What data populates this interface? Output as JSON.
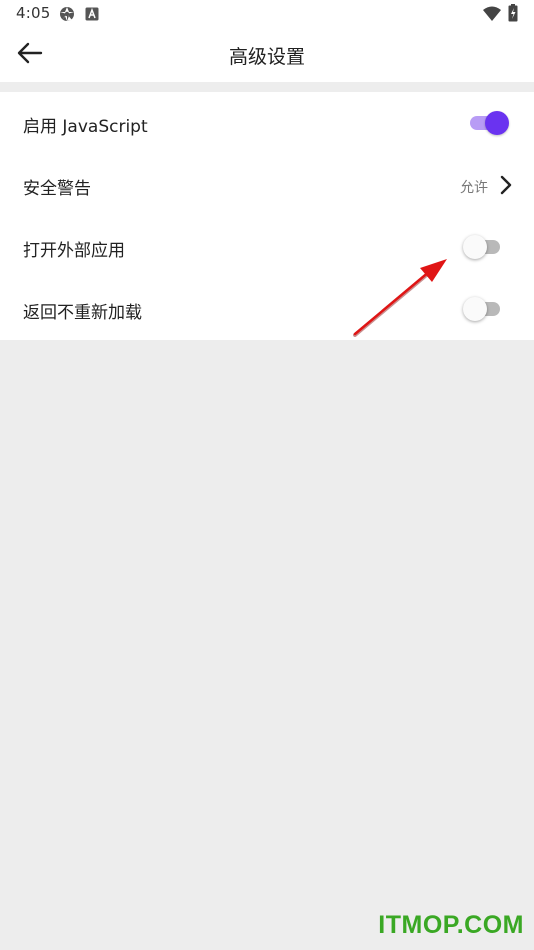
{
  "status_bar": {
    "time": "4:05",
    "left_icons": [
      "settings-gear-icon",
      "a-box-icon"
    ],
    "right_icons": [
      "wifi-icon",
      "battery-charging-icon"
    ]
  },
  "header": {
    "title": "高级设置",
    "back_icon": "arrow-left-icon"
  },
  "settings": [
    {
      "label": "启用 JavaScript",
      "type": "toggle",
      "enabled": true
    },
    {
      "label": "安全警告",
      "type": "link",
      "value": "允许",
      "icon": "chevron-right-icon"
    },
    {
      "label": "打开外部应用",
      "type": "toggle",
      "enabled": false
    },
    {
      "label": "返回不重新加载",
      "type": "toggle",
      "enabled": false
    }
  ],
  "colors": {
    "accent": "#6a33f0",
    "accent_track": "#b89cf5",
    "annotation_arrow": "#e01515",
    "watermark": "#3aa824",
    "background": "#ededed"
  },
  "watermark": "ITMOP.COM"
}
